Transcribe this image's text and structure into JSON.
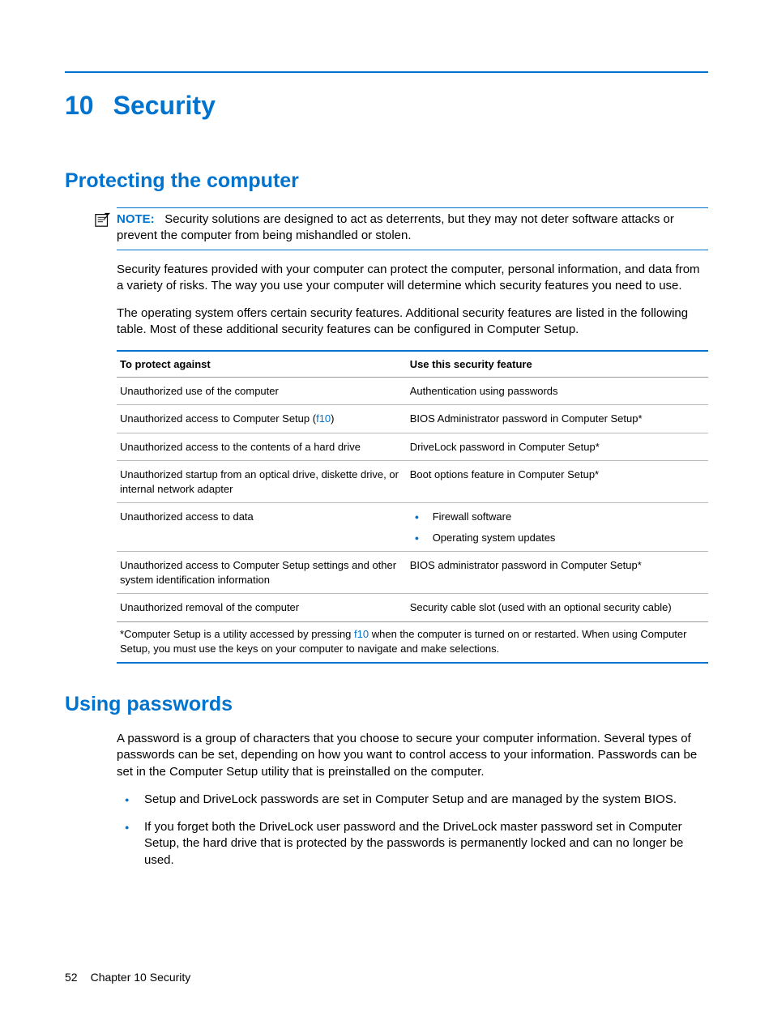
{
  "chapter": {
    "number": "10",
    "title": "Security"
  },
  "section1": {
    "title": "Protecting the computer",
    "note_label": "NOTE:",
    "note_text": "Security solutions are designed to act as deterrents, but they may not deter software attacks or prevent the computer from being mishandled or stolen.",
    "para1": "Security features provided with your computer can protect the computer, personal information, and data from a variety of risks. The way you use your computer will determine which security features you need to use.",
    "para2": "The operating system offers certain security features. Additional security features are listed in the following table. Most of these additional security features can be configured in Computer Setup."
  },
  "table": {
    "header_left": "To protect against",
    "header_right": "Use this security feature",
    "rows": [
      {
        "left": "Unauthorized use of the computer",
        "right": "Authentication using passwords"
      },
      {
        "left_pre": "Unauthorized access to Computer Setup (",
        "left_link": "f10",
        "left_post": ")",
        "right": "BIOS Administrator password in Computer Setup*"
      },
      {
        "left": "Unauthorized access to the contents of a hard drive",
        "right": "DriveLock password in Computer Setup*"
      },
      {
        "left": "Unauthorized startup from an optical drive, diskette drive, or internal network adapter",
        "right": "Boot options feature in Computer Setup*"
      },
      {
        "left": "Unauthorized access to data",
        "right_bullets": [
          "Firewall software",
          "Operating system updates"
        ]
      },
      {
        "left": "Unauthorized access to Computer Setup settings and other system identification information",
        "right": "BIOS administrator password in Computer Setup*"
      },
      {
        "left": "Unauthorized removal of the computer",
        "right": "Security cable slot (used with an optional security cable)"
      }
    ],
    "footnote_pre": "*Computer Setup is a utility accessed by pressing ",
    "footnote_link": "f10",
    "footnote_post": " when the computer is turned on or restarted. When using Computer Setup, you must use the keys on your computer to navigate and make selections."
  },
  "section2": {
    "title": "Using passwords",
    "para1": "A password is a group of characters that you choose to secure your computer information. Several types of passwords can be set, depending on how you want to control access to your information. Passwords can be set in the Computer Setup utility that is preinstalled on the computer.",
    "bullets": [
      "Setup and DriveLock passwords are set in Computer Setup and are managed by the system BIOS.",
      "If you forget both the DriveLock user password and the DriveLock master password set in Computer Setup, the hard drive that is protected by the passwords is permanently locked and can no longer be used."
    ]
  },
  "footer": {
    "page": "52",
    "label": "Chapter 10   Security"
  }
}
